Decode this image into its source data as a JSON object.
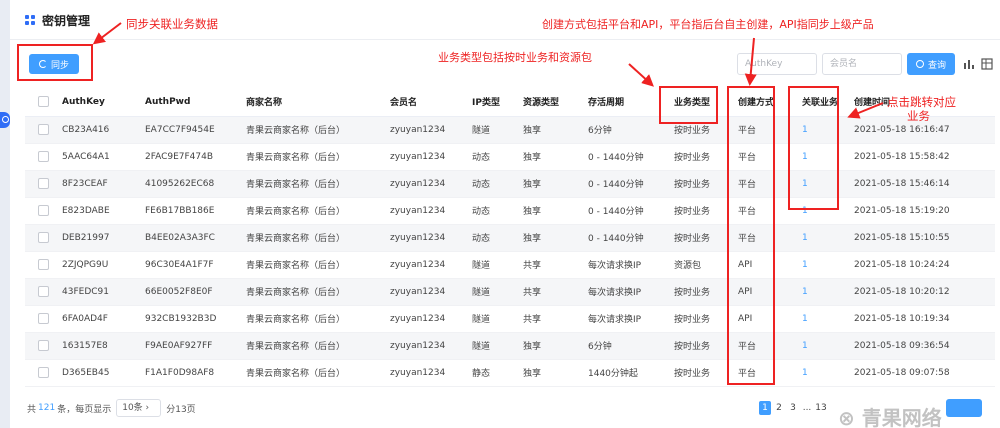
{
  "page": {
    "title": "密钥管理"
  },
  "toolbar": {
    "sync_label": "同步",
    "authkey_placeholder": "AuthKey",
    "member_placeholder": "会员名",
    "search_label": "查询"
  },
  "table": {
    "columns": [
      "AuthKey",
      "AuthPwd",
      "商家名称",
      "会员名",
      "IP类型",
      "资源类型",
      "存活周期",
      "业务类型",
      "创建方式",
      "关联业务",
      "创建时间"
    ],
    "rows": [
      [
        "CB23A416",
        "EA7CC7F9454E",
        "青果云商家名称（后台）",
        "zyuyan1234",
        "隧道",
        "独享",
        "6分钟",
        "按时业务",
        "平台",
        "1",
        "2021-05-18 16:16:47"
      ],
      [
        "5AAC64A1",
        "2FAC9E7F474B",
        "青果云商家名称（后台）",
        "zyuyan1234",
        "动态",
        "独享",
        "0 - 1440分钟",
        "按时业务",
        "平台",
        "1",
        "2021-05-18 15:58:42"
      ],
      [
        "8F23CEAF",
        "41095262EC68",
        "青果云商家名称（后台）",
        "zyuyan1234",
        "动态",
        "独享",
        "0 - 1440分钟",
        "按时业务",
        "平台",
        "1",
        "2021-05-18 15:46:14"
      ],
      [
        "E823DABE",
        "FE6B17BB186E",
        "青果云商家名称（后台）",
        "zyuyan1234",
        "动态",
        "独享",
        "0 - 1440分钟",
        "按时业务",
        "平台",
        "1",
        "2021-05-18 15:19:20"
      ],
      [
        "DEB21997",
        "B4EE02A3A3FC",
        "青果云商家名称（后台）",
        "zyuyan1234",
        "动态",
        "独享",
        "0 - 1440分钟",
        "按时业务",
        "平台",
        "1",
        "2021-05-18 15:10:55"
      ],
      [
        "2ZJQPG9U",
        "96C30E4A1F7F",
        "青果云商家名称（后台）",
        "zyuyan1234",
        "隧道",
        "共享",
        "每次请求换IP",
        "资源包",
        "API",
        "1",
        "2021-05-18 10:24:24"
      ],
      [
        "43FEDC91",
        "66E0052F8E0F",
        "青果云商家名称（后台）",
        "zyuyan1234",
        "隧道",
        "共享",
        "每次请求换IP",
        "按时业务",
        "API",
        "1",
        "2021-05-18 10:20:12"
      ],
      [
        "6FA0AD4F",
        "932CB1932B3D",
        "青果云商家名称（后台）",
        "zyuyan1234",
        "隧道",
        "共享",
        "每次请求换IP",
        "按时业务",
        "API",
        "1",
        "2021-05-18 10:19:34"
      ],
      [
        "163157E8",
        "F9AE0AF927FF",
        "青果云商家名称（后台）",
        "zyuyan1234",
        "隧道",
        "独享",
        "6分钟",
        "按时业务",
        "平台",
        "1",
        "2021-05-18 09:36:54"
      ],
      [
        "D365EB45",
        "F1A1F0D98AF8",
        "青果云商家名称（后台）",
        "zyuyan1234",
        "静态",
        "独享",
        "1440分钟起",
        "按时业务",
        "平台",
        "1",
        "2021-05-18 09:07:58"
      ]
    ]
  },
  "pagination": {
    "prefix": "共",
    "total": "121",
    "mid": "条，每页显示",
    "page_size": "10条",
    "suffix": "分13页",
    "pages": [
      "1",
      "2",
      "3",
      "...",
      "13"
    ]
  },
  "annotations": {
    "sync": "同步关联业务数据",
    "create_method": "创建方式包括平台和API，平台指后台自主创建，API指同步上级产品",
    "business_type": "业务类型包括按时业务和资源包",
    "jump_line1": "点击跳转对应",
    "jump_line2": "业务"
  },
  "watermark": "青果网络",
  "colors": {
    "primary": "#409eff",
    "annotation": "#ee2222"
  }
}
